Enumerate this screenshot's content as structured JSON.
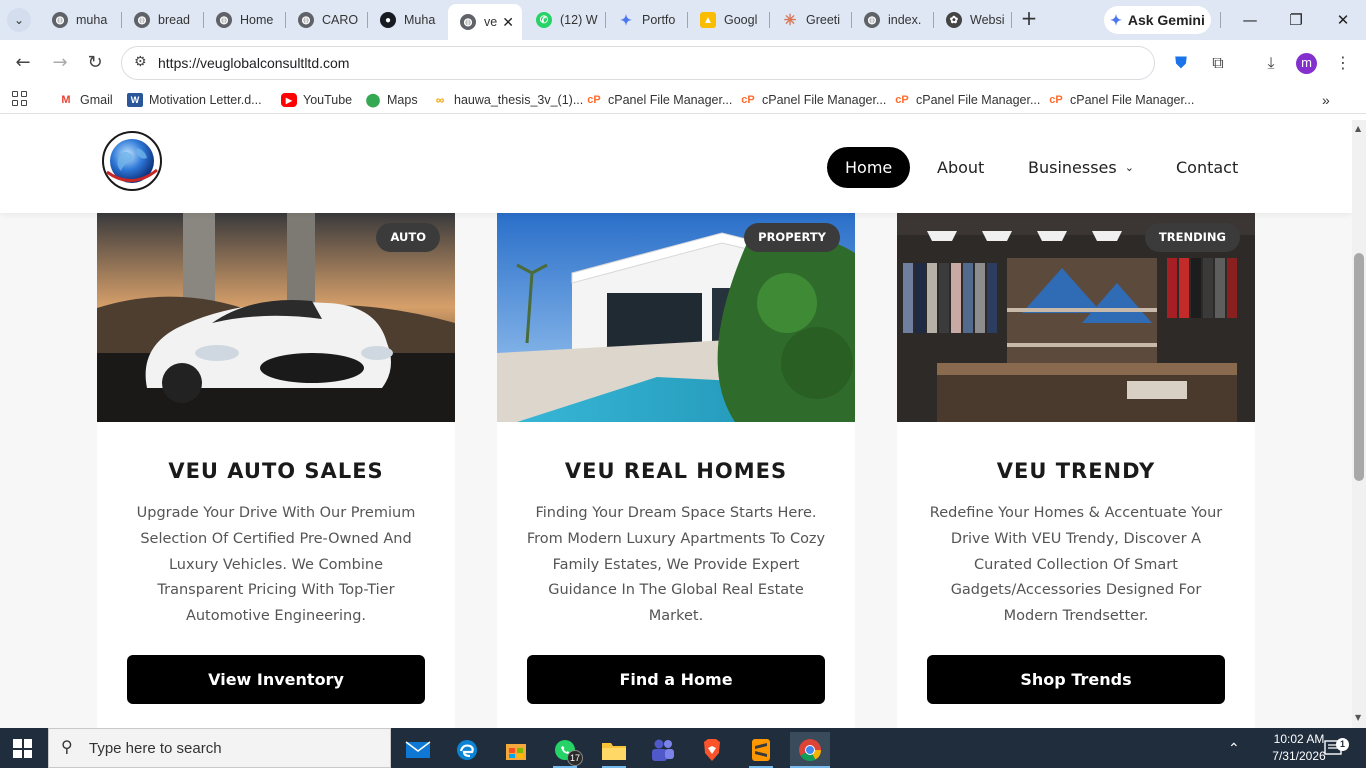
{
  "browser": {
    "tabs": [
      {
        "label": "muha",
        "icon": "globe-icon"
      },
      {
        "label": "bread",
        "icon": "globe-icon"
      },
      {
        "label": "Home",
        "icon": "globe-icon"
      },
      {
        "label": "CARO",
        "icon": "globe-icon"
      },
      {
        "label": "Muha",
        "icon": "github-icon"
      },
      {
        "label": "ve",
        "icon": "globe-icon",
        "active": true
      },
      {
        "label": "(12) W",
        "icon": "whatsapp-icon"
      },
      {
        "label": "Portfo",
        "icon": "gemini-icon"
      },
      {
        "label": "Googl",
        "icon": "google-drive-icon"
      },
      {
        "label": "Greeti",
        "icon": "claude-icon"
      },
      {
        "label": "index.",
        "icon": "globe-icon"
      },
      {
        "label": "Websi",
        "icon": "chatgpt-icon"
      }
    ],
    "ask_gemini_label": "Ask Gemini",
    "url": "https://veuglobalconsultltd.com",
    "bookmarks": [
      {
        "label": "Gmail",
        "icon": "gmail-icon"
      },
      {
        "label": "Motivation Letter.d...",
        "icon": "word-icon"
      },
      {
        "label": "YouTube",
        "icon": "youtube-icon"
      },
      {
        "label": "Maps",
        "icon": "maps-icon"
      },
      {
        "label": "hauwa_thesis_3v_(1)...",
        "icon": "link-icon"
      },
      {
        "label": "cPanel File Manager...",
        "icon": "cpanel-icon"
      },
      {
        "label": "cPanel File Manager...",
        "icon": "cpanel-icon"
      },
      {
        "label": "cPanel File Manager...",
        "icon": "cpanel-icon"
      },
      {
        "label": "cPanel File Manager...",
        "icon": "cpanel-icon"
      }
    ],
    "profile_initial": "m"
  },
  "site": {
    "logo_alt": "VEU Global Consult Limited",
    "nav": [
      {
        "label": "Home",
        "active": true
      },
      {
        "label": "About"
      },
      {
        "label": "Businesses",
        "has_dropdown": true
      },
      {
        "label": "Contact"
      }
    ],
    "cards": [
      {
        "badge": "AUTO",
        "title": "VEU AUTO SALES",
        "description": "Upgrade Your Drive With Our Premium Selection Of Certified Pre-Owned And Luxury Vehicles. We Combine Transparent Pricing With Top-Tier Automotive Engineering.",
        "cta": "View Inventory"
      },
      {
        "badge": "PROPERTY",
        "title": "VEU REAL HOMES",
        "description": "Finding Your Dream Space Starts Here. From Modern Luxury Apartments To Cozy Family Estates, We Provide Expert Guidance In The Global Real Estate Market.",
        "cta": "Find a Home"
      },
      {
        "badge": "TRENDING",
        "title": "VEU TRENDY",
        "description": "Redefine Your Homes & Accentuate Your Drive With VEU Trendy, Discover A Curated Collection Of Smart Gadgets/Accessories Designed For Modern Trendsetter.",
        "cta": "Shop Trends"
      }
    ]
  },
  "taskbar": {
    "search_placeholder": "Type here to search",
    "whatsapp_badge": "17",
    "time": "10:02 AM",
    "date": "7/31/2026",
    "notification_count": "1"
  },
  "colors": {
    "accent": "#000000",
    "badge": "#3b3b3b",
    "tabbar": "#dfe7f4",
    "taskbar": "#1f2d3d"
  }
}
